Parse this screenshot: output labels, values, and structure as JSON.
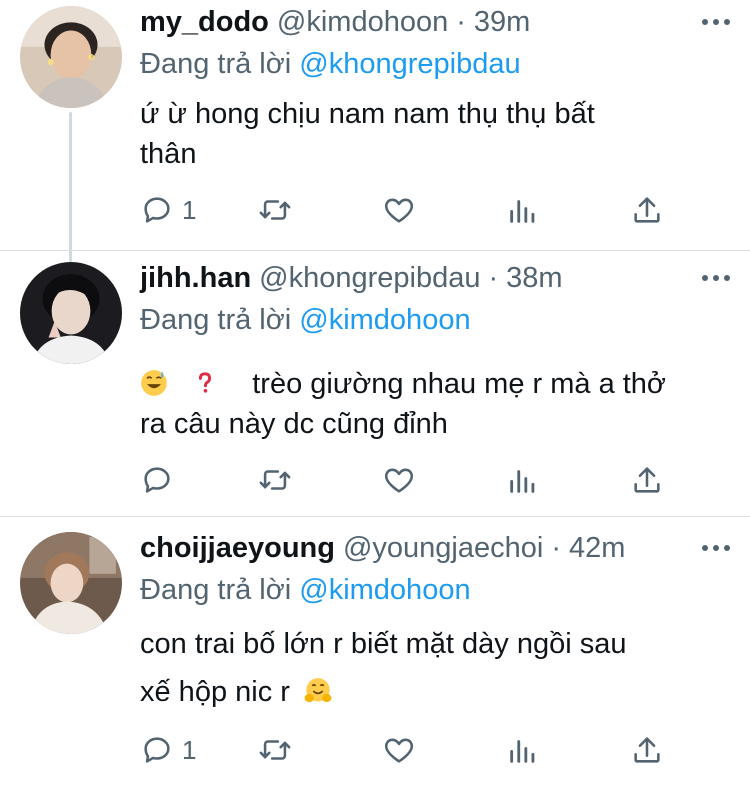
{
  "tweets": [
    {
      "name": "my_dodo",
      "handle": "@kimdohoon",
      "sep": "·",
      "time": "39m",
      "reply_prefix": "Đang trả lời",
      "reply_mention": "@khongrepibdau",
      "text_line1": "ứ ừ hong chịu nam nam thụ thụ bất",
      "text_line2": "thân",
      "reply_count": "1"
    },
    {
      "name": "jihh.han",
      "handle": "@khongrepibdau",
      "sep": "·",
      "time": "38m",
      "reply_prefix": "Đang trả lời",
      "reply_mention": "@kimdohoon",
      "text_line1": "trèo giường nhau mẹ r mà a thở",
      "text_line2": "ra câu này dc cũng đỉnh",
      "reply_count": ""
    },
    {
      "name": "choijjaeyoung",
      "handle": "@youngjaechoi",
      "sep": "·",
      "time": "42m",
      "reply_prefix": "Đang trả lời",
      "reply_mention": "@kimdohoon",
      "text_line1": "con trai bố lớn r biết mặt dày ngồi sau",
      "text_line2": "xế hộp nic r",
      "reply_count": "1"
    }
  ],
  "icons": {
    "reply": "reply-icon",
    "retweet": "retweet-icon",
    "like": "heart-icon",
    "stats": "stats-icon",
    "share": "share-icon",
    "more": "more-icon"
  },
  "colors": {
    "text": "#0f1419",
    "secondary": "#536471",
    "link": "#1d9bf0",
    "divider": "#d9dfe3"
  }
}
